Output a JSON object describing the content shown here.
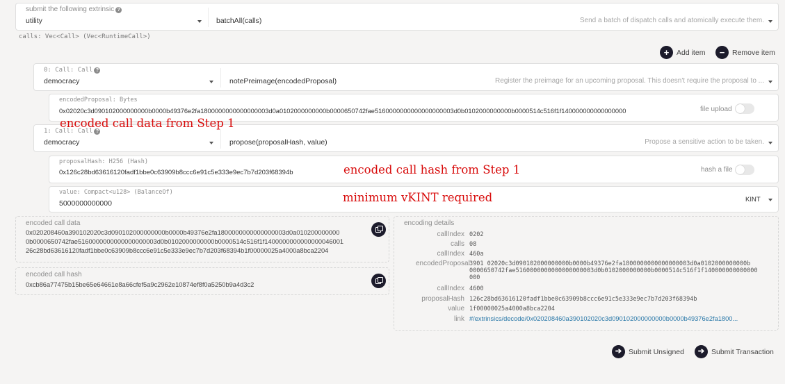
{
  "header": {
    "title": "submit the following extrinsic",
    "module": "utility",
    "method": "batchAll(calls)",
    "method_description": "Send a batch of dispatch calls and atomically execute them."
  },
  "calls_param": "calls: Vec<Call> (Vec<RuntimeCall>)",
  "actions": {
    "add_item": "Add item",
    "remove_item": "Remove item"
  },
  "call0": {
    "title": "0: Call: Call",
    "module": "democracy",
    "method": "notePreimage(encodedProposal)",
    "method_description": "Register the preimage for an upcoming proposal. This doesn't require the proposal to ...",
    "param_label": "encodedProposal: Bytes",
    "param_value": "0x02020c3d090102000000000b0000b49376e2fa1800000000000000003d0a0102000000000b0000650742fae5160000000000000000003d0b0102000000000b0000514c516f1f140000000000000000",
    "toggle_label": "file upload"
  },
  "call1": {
    "title": "1: Call: Call",
    "module": "democracy",
    "method": "propose(proposalHash, value)",
    "method_description": "Propose a sensitive action to be taken.",
    "hash_label": "proposalHash: H256 (Hash)",
    "hash_value": "0x126c28bd63616120fadf1bbe0c63909b8ccc6e91c5e333e9ec7b7d203f68394b",
    "hash_toggle_label": "hash a file",
    "value_label": "value: Compact<u128> (BalanceOf)",
    "value_value": "5000000000000",
    "unit": "KINT"
  },
  "annotations": {
    "step1_data": "encoded call data from Step 1",
    "step1_hash": "encoded call hash from Step 1",
    "min_vkint": "minimum vKINT required"
  },
  "encoded_call_data": {
    "label": "encoded call data",
    "lines": [
      "0x020208460a390102020c3d090102000000000b0000b49376e2fa1800000000000000003d0a010200000000",
      "0b0000650742fae5160000000000000000003d0b0102000000000b0000514c516f1f1400000000000000046001",
      "26c28bd63616120fadf1bbe0c63909b8ccc6e91c5e333e9ec7b7d203f68394b1f00000025a4000a8bca2204"
    ]
  },
  "encoded_call_hash": {
    "label": "encoded call hash",
    "value": "0xcb86a77475b15be65e64661e8a66cfef5a9c2962e10874ef8f0a5250b9a4d3c2"
  },
  "encoding_details": {
    "title": "encoding details",
    "rows": [
      {
        "label": "callIndex",
        "value": "0202"
      },
      {
        "label": "calls",
        "value": "08"
      },
      {
        "label": "callIndex",
        "value": "460a"
      },
      {
        "label": "encodedProposal",
        "value_lines": [
          "3901 02020c3d090102000000000b0000b49376e2fa1800000000000000003d0a0102000000000b",
          "0000650742fae5160000000000000000003d0b0102000000000b0000514c516f1f140000000000000",
          "000"
        ]
      },
      {
        "label": "callIndex",
        "value": "4600"
      },
      {
        "label": "proposalHash",
        "value": "126c28bd63616120fadf1bbe0c63909b8ccc6e91c5e333e9ec7b7d203f68394b"
      },
      {
        "label": "value",
        "value": "1f00000025a4000a8bca2204"
      },
      {
        "label": "link",
        "value": "#/extrinsics/decode/0x020208460a390102020c3d090102000000000b0000b49376e2fa1800..."
      }
    ]
  },
  "footer": {
    "submit_unsigned": "Submit Unsigned",
    "submit_transaction": "Submit Transaction"
  },
  "colors": {
    "accent_dark": "#1c1b2b",
    "annotation_red": "#d80a0a",
    "link_blue": "#2a78a8"
  }
}
